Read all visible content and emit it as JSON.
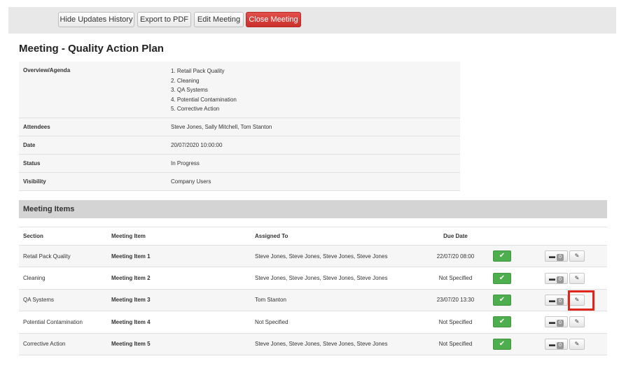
{
  "toolbar": {
    "hide_updates": "Hide Updates History",
    "export_pdf": "Export to PDF",
    "edit_meeting": "Edit Meeting",
    "close_meeting": "Close Meeting"
  },
  "page_title": "Meeting - Quality Action Plan",
  "details": {
    "overview_label": "Overview/Agenda",
    "agenda": [
      "1. Retail Pack Quality",
      "2. Cleaning",
      "3. QA Systems",
      "4. Potential Contamination",
      "5. Corrective Action"
    ],
    "attendees_label": "Attendees",
    "attendees": "Steve Jones, Sally Mitchell, Tom Stanton",
    "date_label": "Date",
    "date": "20/07/2020 10:00:00",
    "status_label": "Status",
    "status": "In Progress",
    "visibility_label": "Visibility",
    "visibility": "Company Users"
  },
  "meeting_items": {
    "heading": "Meeting Items",
    "columns": [
      "Section",
      "Meeting Item",
      "Assigned To",
      "Due Date"
    ],
    "rows": [
      {
        "section": "Retail Pack Quality",
        "item": "Meeting Item 1",
        "assigned": "Steve Jones, Steve Jones, Steve Jones, Steve Jones",
        "due": "22/07/20 08:00",
        "count": "0"
      },
      {
        "section": "Cleaning",
        "item": "Meeting Item 2",
        "assigned": "Steve Jones, Steve Jones, Steve Jones, Steve Jones",
        "due": "Not Specified",
        "count": "0"
      },
      {
        "section": "QA Systems",
        "item": "Meeting Item 3",
        "assigned": "Tom Stanton",
        "due": "23/07/20 13:30",
        "count": "0"
      },
      {
        "section": "Potential Contamination",
        "item": "Meeting Item 4",
        "assigned": "Not Specified",
        "due": "Not Specified",
        "count": "0"
      },
      {
        "section": "Corrective Action",
        "item": "Meeting Item 5",
        "assigned": "Steve Jones, Steve Jones, Steve Jones, Steve Jones",
        "due": "Not Specified",
        "count": "0"
      }
    ]
  },
  "icons": {
    "check": "check-icon",
    "comment": "comment-icon",
    "edit": "edit-icon"
  },
  "colors": {
    "danger": "#d9534f",
    "success": "#4cae4c",
    "highlight": "#e0251b"
  }
}
